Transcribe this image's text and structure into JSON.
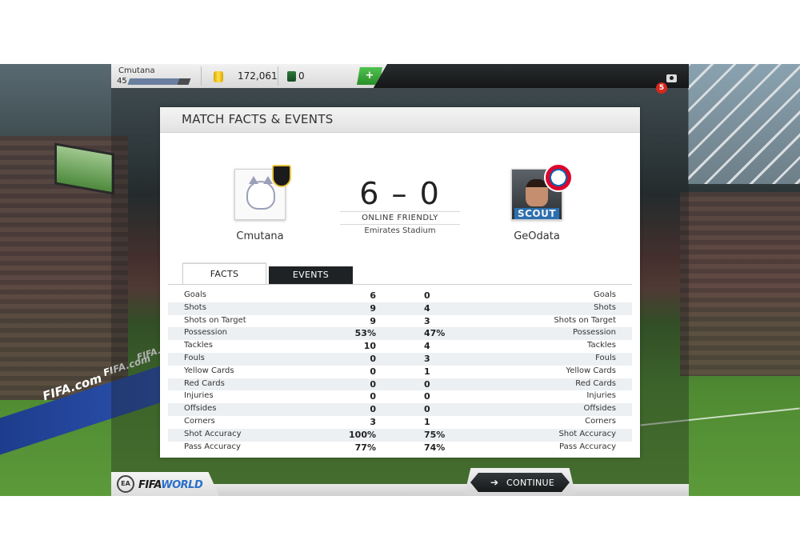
{
  "topbar": {
    "username": "Cmutana",
    "level": "45",
    "xp_progress": 0.82,
    "coins": "172,061",
    "points": "0",
    "add_label": "+",
    "notifications": "5"
  },
  "card": {
    "title": "MATCH FACTS & EVENTS",
    "home_team": "Cmutana",
    "away_team": "GeOdata",
    "score": "6 – 0",
    "match_type": "ONLINE FRIENDLY",
    "stadium": "Emirates Stadium",
    "away_badge_label": "SCOUT",
    "tabs": [
      "FACTS",
      "EVENTS"
    ],
    "stats": [
      {
        "label": "Goals",
        "home": "6",
        "away": "0"
      },
      {
        "label": "Shots",
        "home": "9",
        "away": "4"
      },
      {
        "label": "Shots on Target",
        "home": "9",
        "away": "3"
      },
      {
        "label": "Possession",
        "home": "53%",
        "away": "47%"
      },
      {
        "label": "Tackles",
        "home": "10",
        "away": "4"
      },
      {
        "label": "Fouls",
        "home": "0",
        "away": "3"
      },
      {
        "label": "Yellow Cards",
        "home": "0",
        "away": "1"
      },
      {
        "label": "Red Cards",
        "home": "0",
        "away": "0"
      },
      {
        "label": "Injuries",
        "home": "0",
        "away": "0"
      },
      {
        "label": "Offsides",
        "home": "0",
        "away": "0"
      },
      {
        "label": "Corners",
        "home": "3",
        "away": "1"
      },
      {
        "label": "Shot Accuracy",
        "home": "100%",
        "away": "75%"
      },
      {
        "label": "Pass Accuracy",
        "home": "77%",
        "away": "74%"
      }
    ]
  },
  "footer": {
    "ea_logo": "EA",
    "fifa_logo_main": "FIFA",
    "fifa_logo_accent": "WORLD",
    "continue_label": "CONTINUE"
  },
  "background": {
    "ad_text_1": "FIFA.com",
    "ad_text_2": "FIFA.com",
    "ad_text_3": "FIFA.com"
  },
  "colors": {
    "tab_active_bg": "#ffffff",
    "tab_inactive_bg": "#1f2224",
    "notification": "#d9261c",
    "add_button": "#3aa83a"
  }
}
